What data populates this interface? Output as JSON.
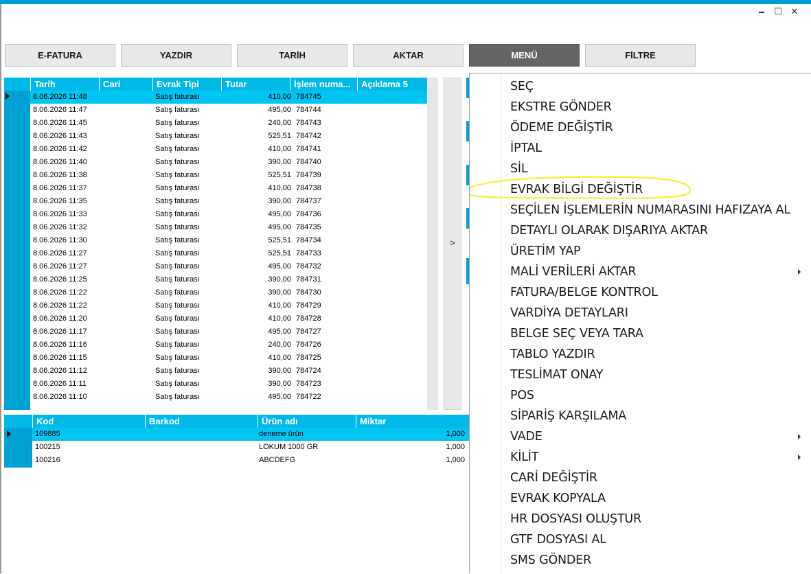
{
  "window": {
    "minimize": "🗕",
    "maximize": "☐",
    "close": "✕"
  },
  "toolbar": [
    {
      "label": "E-FATURA"
    },
    {
      "label": "YAZDIR"
    },
    {
      "label": "TARİH"
    },
    {
      "label": "AKTAR"
    },
    {
      "label": "MENÜ"
    },
    {
      "label": "FİLTRE"
    }
  ],
  "grid_main": {
    "columns": [
      "Tarih",
      "Cari",
      "Evrak Tipi",
      "Tutar",
      "İşlem numa...",
      "Açıklama 5"
    ],
    "rows": [
      {
        "tarih": "8.06.2026 11:48",
        "cari": "",
        "tip": "Satış faturası",
        "tutar": "410,00",
        "no": "784745"
      },
      {
        "tarih": "8.06.2026 11:47",
        "cari": "",
        "tip": "Satış faturası",
        "tutar": "495,00",
        "no": "784744"
      },
      {
        "tarih": "8.06.2026 11:45",
        "cari": "",
        "tip": "Satış faturası",
        "tutar": "240,00",
        "no": "784743"
      },
      {
        "tarih": "8.06.2026 11:43",
        "cari": "",
        "tip": "Satış faturası",
        "tutar": "525,51",
        "no": "784742"
      },
      {
        "tarih": "8.06.2026 11:42",
        "cari": "",
        "tip": "Satış faturası",
        "tutar": "410,00",
        "no": "784741"
      },
      {
        "tarih": "8.06.2026 11:40",
        "cari": "",
        "tip": "Satış faturası",
        "tutar": "390,00",
        "no": "784740"
      },
      {
        "tarih": "8.06.2026 11:38",
        "cari": "",
        "tip": "Satış faturası",
        "tutar": "525,51",
        "no": "784739"
      },
      {
        "tarih": "8.06.2026 11:37",
        "cari": "",
        "tip": "Satış faturası",
        "tutar": "410,00",
        "no": "784738"
      },
      {
        "tarih": "8.06.2026 11:35",
        "cari": "",
        "tip": "Satış faturası",
        "tutar": "390,00",
        "no": "784737"
      },
      {
        "tarih": "8.06.2026 11:33",
        "cari": "",
        "tip": "Satış faturası",
        "tutar": "495,00",
        "no": "784736"
      },
      {
        "tarih": "8.06.2026 11:32",
        "cari": "",
        "tip": "Satış faturası",
        "tutar": "495,00",
        "no": "784735"
      },
      {
        "tarih": "8.06.2026 11:30",
        "cari": "",
        "tip": "Satış faturası",
        "tutar": "525,51",
        "no": "784734"
      },
      {
        "tarih": "8.06.2026 11:27",
        "cari": "",
        "tip": "Satış faturası",
        "tutar": "525,51",
        "no": "784733"
      },
      {
        "tarih": "8.06.2026 11:27",
        "cari": "",
        "tip": "Satış faturası",
        "tutar": "495,00",
        "no": "784732"
      },
      {
        "tarih": "8.06.2026 11:25",
        "cari": "",
        "tip": "Satış faturası",
        "tutar": "390,00",
        "no": "784731"
      },
      {
        "tarih": "8.06.2026 11:22",
        "cari": "",
        "tip": "Satış faturası",
        "tutar": "390,00",
        "no": "784730"
      },
      {
        "tarih": "8.06.2026 11:22",
        "cari": "",
        "tip": "Satış faturası",
        "tutar": "410,00",
        "no": "784729"
      },
      {
        "tarih": "8.06.2026 11:20",
        "cari": "",
        "tip": "Satış faturası",
        "tutar": "410,00",
        "no": "784728"
      },
      {
        "tarih": "8.06.2026 11:17",
        "cari": "",
        "tip": "Satış faturası",
        "tutar": "495,00",
        "no": "784727"
      },
      {
        "tarih": "8.06.2026 11:16",
        "cari": "",
        "tip": "Satış faturası",
        "tutar": "240,00",
        "no": "784726"
      },
      {
        "tarih": "8.06.2026 11:15",
        "cari": "",
        "tip": "Satış faturası",
        "tutar": "410,00",
        "no": "784725"
      },
      {
        "tarih": "8.06.2026 11:12",
        "cari": "",
        "tip": "Satış faturası",
        "tutar": "390,00",
        "no": "784724"
      },
      {
        "tarih": "8.06.2026 11:11",
        "cari": "",
        "tip": "Satış faturası",
        "tutar": "390,00",
        "no": "784723"
      },
      {
        "tarih": "8.06.2026 11:10",
        "cari": "",
        "tip": "Satış faturası",
        "tutar": "495,00",
        "no": "784722"
      }
    ]
  },
  "expander": {
    "label": ">"
  },
  "grid_items": {
    "columns": [
      "Kod",
      "Barkod",
      "Ürün adı",
      "Miktar"
    ],
    "rows": [
      {
        "kod": "109885",
        "barkod": "",
        "ad": "deneme ürün",
        "miktar": "1,000"
      },
      {
        "kod": "100215",
        "barkod": "",
        "ad": "LOKUM 1000 GR",
        "miktar": "1,000"
      },
      {
        "kod": "100216",
        "barkod": "",
        "ad": "ABCDEFG",
        "miktar": "1,000"
      }
    ]
  },
  "menu": {
    "highlight_color": "#f5ef3a",
    "highlighted_item": "EVRAK BİLGİ DEĞİŞTİR",
    "items": [
      {
        "label": "SEÇ",
        "submenu": false
      },
      {
        "label": "EKSTRE GÖNDER",
        "submenu": false
      },
      {
        "label": "ÖDEME DEĞİŞTİR",
        "submenu": false
      },
      {
        "label": "İPTAL",
        "submenu": false
      },
      {
        "label": "SİL",
        "submenu": false
      },
      {
        "label": "EVRAK BİLGİ DEĞİŞTİR",
        "submenu": false
      },
      {
        "label": "SEÇİLEN İŞLEMLERİN NUMARASINI HAFIZAYA AL",
        "submenu": false
      },
      {
        "label": "DETAYLI OLARAK DIŞARIYA AKTAR",
        "submenu": false
      },
      {
        "label": "ÜRETİM YAP",
        "submenu": false
      },
      {
        "label": "MALİ VERİLERİ AKTAR",
        "submenu": true
      },
      {
        "label": "FATURA/BELGE KONTROL",
        "submenu": false
      },
      {
        "label": "VARDİYA DETAYLARI",
        "submenu": false
      },
      {
        "label": "BELGE SEÇ VEYA TARA",
        "submenu": false
      },
      {
        "label": "TABLO YAZDIR",
        "submenu": false
      },
      {
        "label": "TESLİMAT ONAY",
        "submenu": false
      },
      {
        "label": "POS",
        "submenu": false
      },
      {
        "label": "SİPARİŞ KARŞILAMA",
        "submenu": false
      },
      {
        "label": "VADE",
        "submenu": true
      },
      {
        "label": "KİLİT",
        "submenu": true
      },
      {
        "label": "CARİ DEĞİŞTİR",
        "submenu": false
      },
      {
        "label": "EVRAK KOPYALA",
        "submenu": false
      },
      {
        "label": "HR DOSYASI OLUŞTUR",
        "submenu": false
      },
      {
        "label": "GTF DOSYASI AL",
        "submenu": false
      },
      {
        "label": "SMS GÖNDER",
        "submenu": false
      }
    ]
  }
}
